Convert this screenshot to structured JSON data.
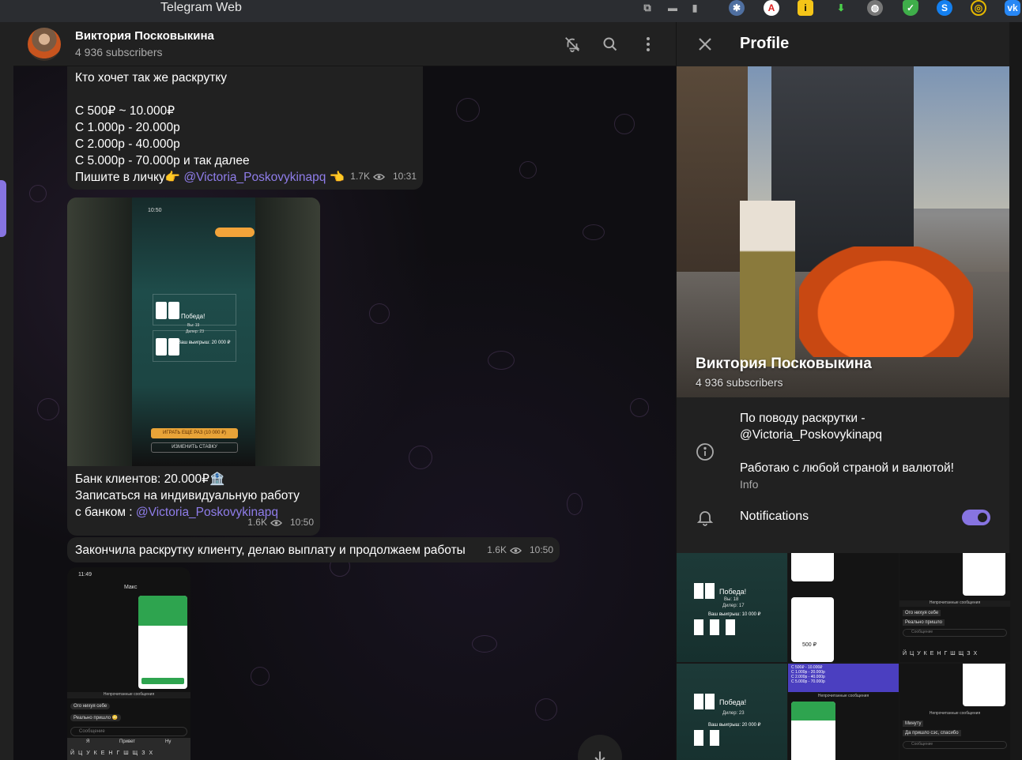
{
  "window": {
    "title": "Telegram Web"
  },
  "extensions": [
    "translate-icon",
    "chat-icon",
    "bookmark-icon",
    "puzzle-icon",
    "adblock-icon",
    "yandex-icon",
    "download-icon",
    "globe-icon",
    "shield-icon",
    "shazam-icon",
    "crypto-icon",
    "vk-icon"
  ],
  "chat": {
    "name": "Виктория Посковыкина",
    "subscribers": "4 936 subscribers"
  },
  "messages": {
    "m1": {
      "lines": [
        "Кто хочет так же раскрутку",
        "",
        "С 500₽ ~ 10.000₽",
        "С 1.000р - 20.000р",
        "С 2.000р - 40.000р",
        "С 5.000р - 70.000р и так далее"
      ],
      "last_prefix": "Пишите в личку👉 ",
      "link": "@Victoria_Poskovykinapq",
      "last_suffix": " 👈",
      "views": "1.7K",
      "time": "10:31"
    },
    "m2": {
      "media": {
        "status_time": "10:50",
        "player_label": "Дилер: 23",
        "win_label": "Победа!",
        "score_label": "Вы: 19",
        "winnings": "Ваш выигрыш: 20 000 ₽",
        "play_again": "ИГРАТЬ ЕЩЕ РАЗ (10 000 ₽)",
        "change_bet": "ИЗМЕНИТЬ СТАВКУ"
      },
      "line1": "Банк клиентов: 20.000₽🏦",
      "line2": "Записаться на индивидуальную работу",
      "line3_prefix": "с банком : ",
      "link": "@Victoria_Poskovykinapq",
      "views": "1.6K",
      "time": "10:50"
    },
    "m3": {
      "text": "Закончила раскрутку клиенту, делаю выплату и продолжаем работы",
      "views": "1.6K",
      "time": "10:50"
    },
    "m4": {
      "status_time": "11:49",
      "contact": "Макс",
      "unread_label": "Непрочитанные сообщения",
      "msg_a": "Ого нихуя себе",
      "msg_b": "Реально пришло 😳",
      "input_placeholder": "Сообщение",
      "suggestions": [
        "Я",
        "Привет",
        "Ну"
      ],
      "keys": "ЙЦУКЕНГШЩЗХ"
    }
  },
  "profile": {
    "title": "Profile",
    "name": "Виктория Посковыкина",
    "subscribers": "4 936 subscribers",
    "info_line1": "По поводу раскрутки -",
    "info_link": "@Victoria_Poskovykinapq",
    "info_line2": "Работаю с любой страной и валютой!",
    "info_label": "Info",
    "notifications_label": "Notifications",
    "notifications_on": true,
    "gallery": {
      "win": "Победа!",
      "you": "Вы: 18",
      "dealer": "Дилер: 17",
      "dealer2": "Дилер: 23",
      "winnings": "Ваш выигрыш: 10 000 ₽",
      "winnings2": "Ваш выигрыш: 20 000 ₽",
      "amount": "500 ₽",
      "unread": "Непрочитанные сообщения",
      "input": "Сообщение",
      "msg_a": "Ого нихуя себе",
      "msg_b": "Реально пришло",
      "msg_c": "Минуту",
      "msg_d": "Да пришло сэс, спасибо",
      "price_lines": [
        "С 500₽ - 10.000₽",
        "С 1.000р - 20.000р",
        "С 2.000р - 40.000р",
        "С 5.000р - 70.000р"
      ],
      "keys": "ЙЦУКЕНГШЩЗХ",
      "sender_a": "Выигрыш",
      "sender_b": "Выигрыш"
    }
  },
  "colors": {
    "accent": "#8774e1",
    "link": "#8f7dea",
    "bubble": "#212121",
    "panel": "#212121"
  }
}
